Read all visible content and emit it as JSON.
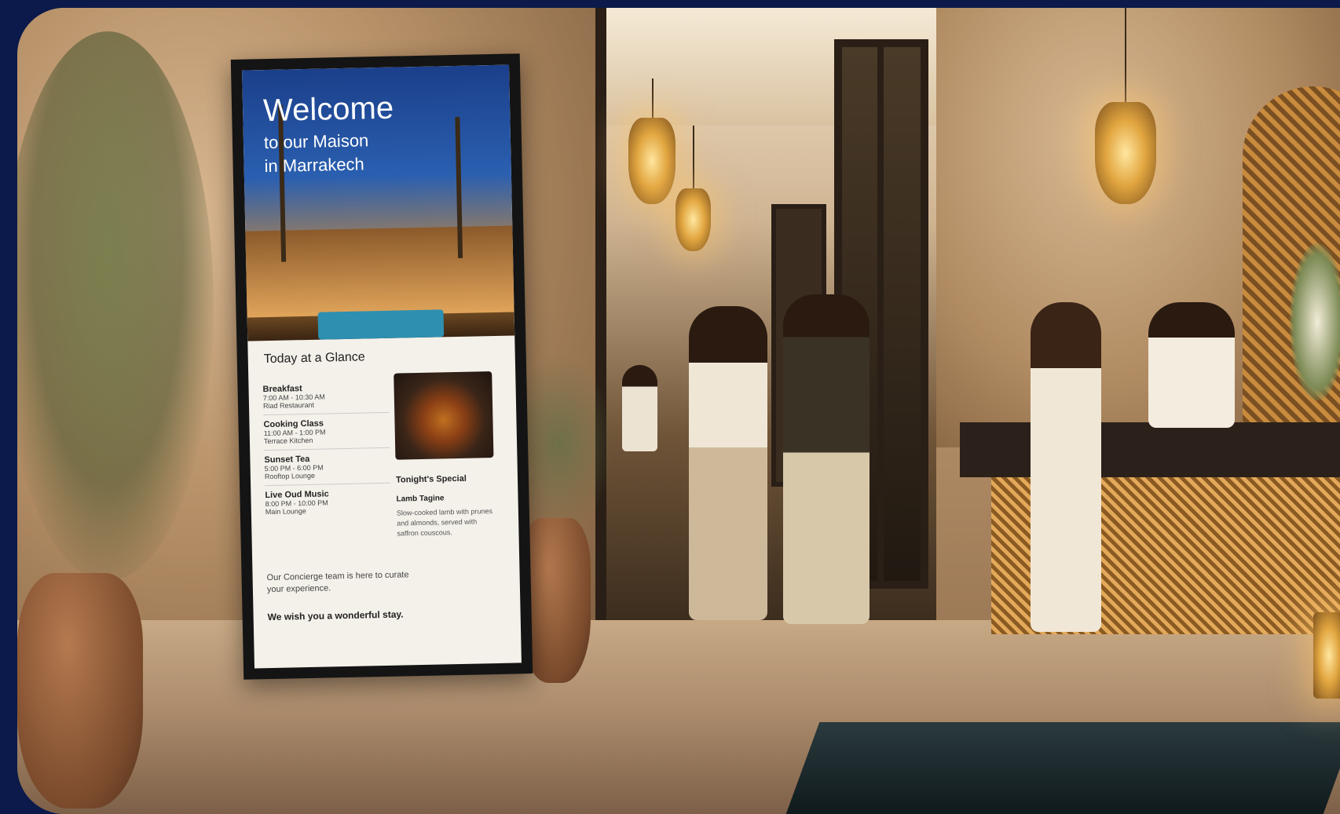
{
  "signage": {
    "title": "Welcome",
    "subtitle_line1": "to our Maison",
    "subtitle_line2": "in Marrakech",
    "glance_title": "Today at a Glance",
    "events": [
      {
        "name": "Breakfast",
        "time": "7:00 AM - 10:30 AM",
        "place": "Riad Restaurant"
      },
      {
        "name": "Cooking Class",
        "time": "11:00 AM - 1:00 PM",
        "place": "Terrace Kitchen"
      },
      {
        "name": "Sunset Tea",
        "time": "5:00 PM - 6:00 PM",
        "place": "Rooftop Lounge"
      },
      {
        "name": "Live Oud Music",
        "time": "8:00 PM - 10:00 PM",
        "place": "Main Lounge"
      }
    ],
    "special_title": "Tonight's Special",
    "special_name": "Lamb Tagine",
    "special_desc": "Slow-cooked lamb with prunes and almonds, served with saffron couscous.",
    "concierge": "Our Concierge team is here to curate your experience.",
    "wish": "We wish you a wonderful stay."
  }
}
